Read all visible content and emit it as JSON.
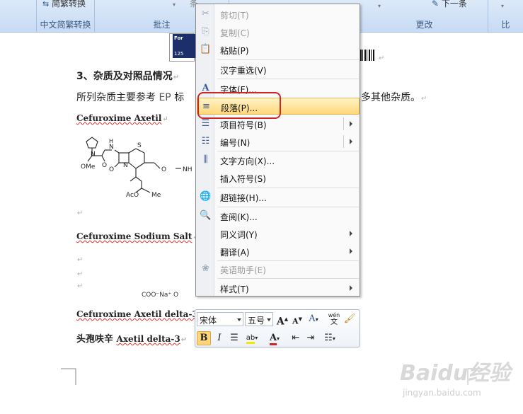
{
  "ribbon": {
    "group1_top": "简繁转换",
    "group1_label": "中文简繁转换",
    "group2_top": "条",
    "group2_label": "批注",
    "group3_top": "下一条",
    "group3_label": "更改",
    "group4_label": "比"
  },
  "document": {
    "heading": "3、杂质及对照品情况",
    "intro_left": "所列杂质主要参考",
    "intro_ep": "EP",
    "intro_mid": "标",
    "intro_right": "多其他杂质。",
    "compound1": "Cefuroxime Axetil",
    "compound2": "Cefuroxime Sodium Salt",
    "compound3": "Cefuroxime Axetil delta-3",
    "compound4_cn": "头孢呋辛",
    "compound4_en": "Axetil delta-3",
    "struct_label": "COO⁻Na⁺ O",
    "struct": {
      "nome": "N",
      "ome": "OMe",
      "nh1": "N",
      "h1": "H",
      "s": "S",
      "n2": "N",
      "o1": "O",
      "o2": "O",
      "o3": "O",
      "nh2": "NH",
      "aco": "AcO",
      "me": "Me"
    },
    "banner_for": "For",
    "banner_125": "125"
  },
  "context_menu": {
    "items": [
      {
        "label": "剪切(T)",
        "icon": "scissors-icon",
        "disabled": true
      },
      {
        "label": "复制(C)",
        "icon": "copy-icon",
        "disabled": true
      },
      {
        "label": "粘贴(P)",
        "icon": "paste-icon",
        "disabled": false
      },
      {
        "label": "汉字重选(V)",
        "icon": "",
        "disabled": false
      },
      {
        "label": "字体(F)...",
        "icon": "font-icon",
        "disabled": false
      },
      {
        "label": "段落(P)...",
        "icon": "paragraph-icon",
        "disabled": false,
        "highlighted": true
      },
      {
        "label": "项目符号(B)",
        "icon": "bullets-icon",
        "disabled": false,
        "submenu": true
      },
      {
        "label": "编号(N)",
        "icon": "numbering-icon",
        "disabled": false,
        "submenu": true
      },
      {
        "label": "文字方向(X)...",
        "icon": "text-direction-icon",
        "disabled": false
      },
      {
        "label": "插入符号(S)",
        "icon": "",
        "disabled": false
      },
      {
        "label": "超链接(H)...",
        "icon": "hyperlink-icon",
        "disabled": false
      },
      {
        "label": "查阅(K)...",
        "icon": "research-icon",
        "disabled": false
      },
      {
        "label": "同义词(Y)",
        "icon": "",
        "disabled": false,
        "submenu": true
      },
      {
        "label": "翻译(A)",
        "icon": "",
        "disabled": false,
        "submenu": true
      },
      {
        "label": "英语助手(E)",
        "icon": "english-assistant-icon",
        "disabled": true
      },
      {
        "label": "样式(T)",
        "icon": "",
        "disabled": false,
        "submenu": true
      }
    ]
  },
  "mini_toolbar": {
    "font_name": "宋体",
    "font_size": "五号",
    "grow_font": "A",
    "shrink_font": "A",
    "font_color_letter": "A",
    "bold": "B",
    "italic": "I",
    "highlight": "ab",
    "phonetic": "wén",
    "colors": {
      "highlight": "#f5e600",
      "font_color": "#d42020"
    }
  },
  "watermark": {
    "brand": "Baidu经验",
    "url": "jingyan.baidu.com"
  }
}
